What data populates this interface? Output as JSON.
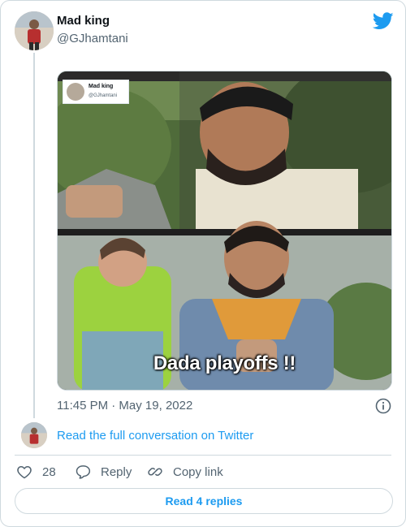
{
  "user": {
    "name": "Mad king",
    "handle": "@GJhamtani"
  },
  "media": {
    "inner_tweet_name": "Mad king",
    "inner_tweet_handle": "@GJhamtani",
    "caption": "Dada playoffs !!"
  },
  "meta": {
    "timestamp": "11:45 PM · May 19, 2022"
  },
  "conversation": {
    "link_text": "Read the full conversation on Twitter"
  },
  "actions": {
    "like_count": "28",
    "reply_label": "Reply",
    "copy_label": "Copy link",
    "read_replies_label": "Read 4 replies"
  },
  "colors": {
    "accent": "#1d9bf0",
    "text_primary": "#0f1419",
    "text_secondary": "#536471",
    "border": "#cfd9de"
  },
  "icons": [
    "twitter-bird-icon",
    "info-icon",
    "heart-icon",
    "reply-icon",
    "link-icon"
  ]
}
